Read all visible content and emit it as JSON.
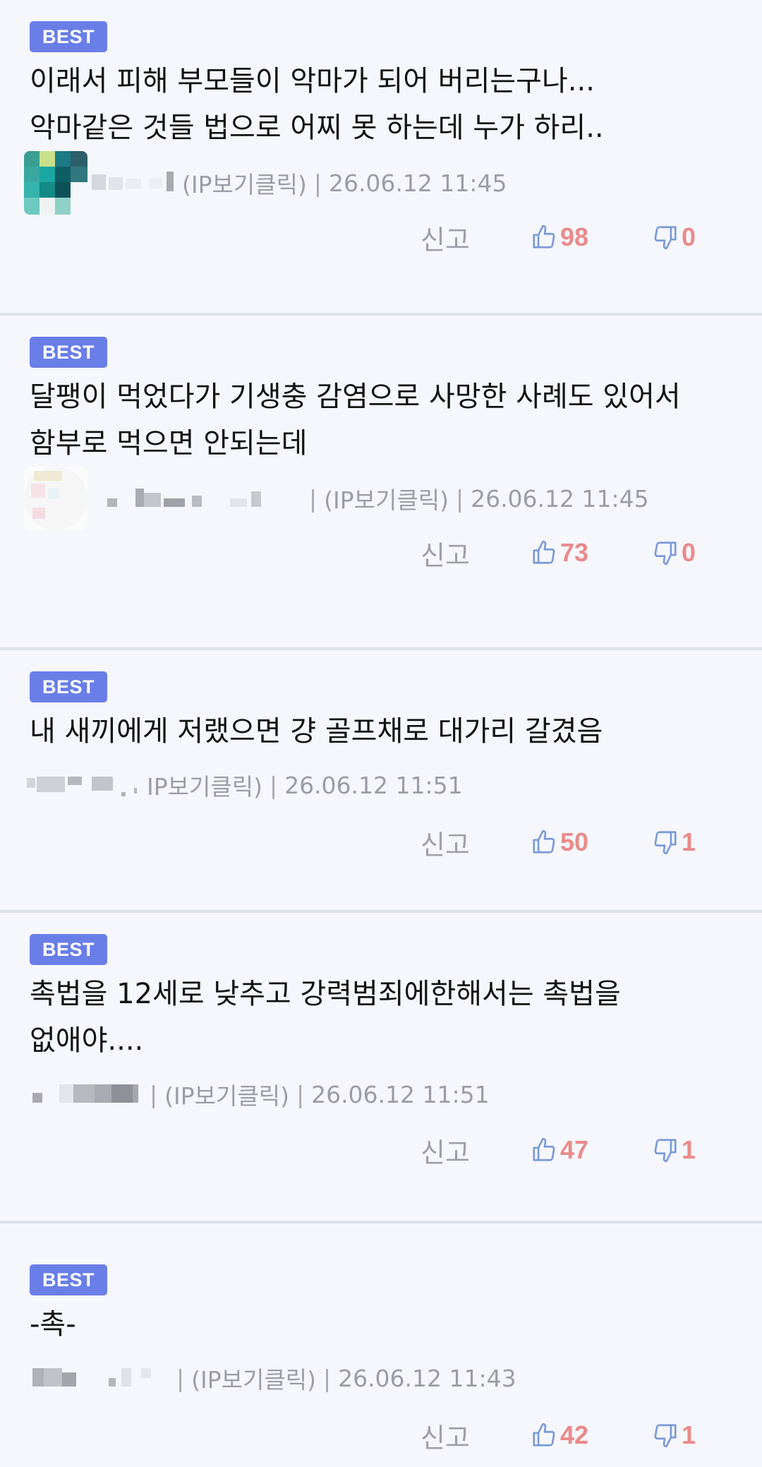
{
  "comments": [
    {
      "badge": "BEST",
      "text": "이래서 피해 부모들이 악마가 되어 버리는구나...\n악마같은 것들 법으로 어찌 못 하는데 누가 하리..",
      "ip_label": "(IP보기클릭)",
      "timestamp": "26.06.12 11:45",
      "report_label": "신고",
      "likes": "98",
      "dislikes": "0"
    },
    {
      "badge": "BEST",
      "text": "달팽이 먹었다가 기생충 감염으로 사망한 사례도 있어서 함부로 먹으면 안되는데",
      "ip_label": "(IP보기클릭)",
      "timestamp": "26.06.12 11:45",
      "report_label": "신고",
      "likes": "73",
      "dislikes": "0"
    },
    {
      "badge": "BEST",
      "text": "내 새끼에게 저랬으면 걍 골프채로 대가리 갈겼음",
      "ip_label": "IP보기클릭)",
      "timestamp": "26.06.12 11:51",
      "report_label": "신고",
      "likes": "50",
      "dislikes": "1"
    },
    {
      "badge": "BEST",
      "text": "촉법을 12세로 낮추고 강력범죄에한해서는 촉법을 없애야....",
      "ip_label": "(IP보기클릭)",
      "timestamp": "26.06.12 11:51",
      "report_label": "신고",
      "likes": "47",
      "dislikes": "1"
    },
    {
      "badge": "BEST",
      "text": "-촉-",
      "ip_label": "(IP보기클릭)",
      "timestamp": "26.06.12 11:43",
      "report_label": "신고",
      "likes": "42",
      "dislikes": "1"
    }
  ],
  "colors": {
    "badge": "#6a7ee8",
    "count": "#ea8a8a",
    "icon": "#7b9ad8",
    "meta": "#9a9da5",
    "divider": "#dde1e8",
    "background": "#f5f7fc"
  },
  "icons": {
    "like": "thumbs-up-icon",
    "dislike": "thumbs-down-icon"
  }
}
